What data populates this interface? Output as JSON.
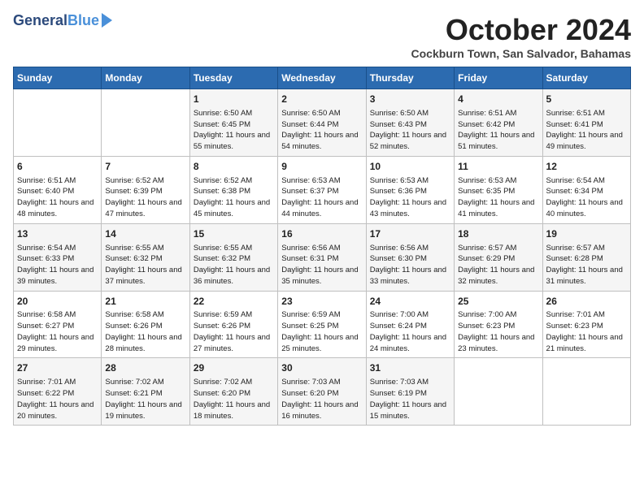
{
  "header": {
    "logo_line1": "General",
    "logo_line2": "Blue",
    "title": "October 2024",
    "location": "Cockburn Town, San Salvador, Bahamas"
  },
  "days_of_week": [
    "Sunday",
    "Monday",
    "Tuesday",
    "Wednesday",
    "Thursday",
    "Friday",
    "Saturday"
  ],
  "weeks": [
    [
      {
        "day": "",
        "info": ""
      },
      {
        "day": "",
        "info": ""
      },
      {
        "day": "1",
        "info": "Sunrise: 6:50 AM\nSunset: 6:45 PM\nDaylight: 11 hours and 55 minutes."
      },
      {
        "day": "2",
        "info": "Sunrise: 6:50 AM\nSunset: 6:44 PM\nDaylight: 11 hours and 54 minutes."
      },
      {
        "day": "3",
        "info": "Sunrise: 6:50 AM\nSunset: 6:43 PM\nDaylight: 11 hours and 52 minutes."
      },
      {
        "day": "4",
        "info": "Sunrise: 6:51 AM\nSunset: 6:42 PM\nDaylight: 11 hours and 51 minutes."
      },
      {
        "day": "5",
        "info": "Sunrise: 6:51 AM\nSunset: 6:41 PM\nDaylight: 11 hours and 49 minutes."
      }
    ],
    [
      {
        "day": "6",
        "info": "Sunrise: 6:51 AM\nSunset: 6:40 PM\nDaylight: 11 hours and 48 minutes."
      },
      {
        "day": "7",
        "info": "Sunrise: 6:52 AM\nSunset: 6:39 PM\nDaylight: 11 hours and 47 minutes."
      },
      {
        "day": "8",
        "info": "Sunrise: 6:52 AM\nSunset: 6:38 PM\nDaylight: 11 hours and 45 minutes."
      },
      {
        "day": "9",
        "info": "Sunrise: 6:53 AM\nSunset: 6:37 PM\nDaylight: 11 hours and 44 minutes."
      },
      {
        "day": "10",
        "info": "Sunrise: 6:53 AM\nSunset: 6:36 PM\nDaylight: 11 hours and 43 minutes."
      },
      {
        "day": "11",
        "info": "Sunrise: 6:53 AM\nSunset: 6:35 PM\nDaylight: 11 hours and 41 minutes."
      },
      {
        "day": "12",
        "info": "Sunrise: 6:54 AM\nSunset: 6:34 PM\nDaylight: 11 hours and 40 minutes."
      }
    ],
    [
      {
        "day": "13",
        "info": "Sunrise: 6:54 AM\nSunset: 6:33 PM\nDaylight: 11 hours and 39 minutes."
      },
      {
        "day": "14",
        "info": "Sunrise: 6:55 AM\nSunset: 6:32 PM\nDaylight: 11 hours and 37 minutes."
      },
      {
        "day": "15",
        "info": "Sunrise: 6:55 AM\nSunset: 6:32 PM\nDaylight: 11 hours and 36 minutes."
      },
      {
        "day": "16",
        "info": "Sunrise: 6:56 AM\nSunset: 6:31 PM\nDaylight: 11 hours and 35 minutes."
      },
      {
        "day": "17",
        "info": "Sunrise: 6:56 AM\nSunset: 6:30 PM\nDaylight: 11 hours and 33 minutes."
      },
      {
        "day": "18",
        "info": "Sunrise: 6:57 AM\nSunset: 6:29 PM\nDaylight: 11 hours and 32 minutes."
      },
      {
        "day": "19",
        "info": "Sunrise: 6:57 AM\nSunset: 6:28 PM\nDaylight: 11 hours and 31 minutes."
      }
    ],
    [
      {
        "day": "20",
        "info": "Sunrise: 6:58 AM\nSunset: 6:27 PM\nDaylight: 11 hours and 29 minutes."
      },
      {
        "day": "21",
        "info": "Sunrise: 6:58 AM\nSunset: 6:26 PM\nDaylight: 11 hours and 28 minutes."
      },
      {
        "day": "22",
        "info": "Sunrise: 6:59 AM\nSunset: 6:26 PM\nDaylight: 11 hours and 27 minutes."
      },
      {
        "day": "23",
        "info": "Sunrise: 6:59 AM\nSunset: 6:25 PM\nDaylight: 11 hours and 25 minutes."
      },
      {
        "day": "24",
        "info": "Sunrise: 7:00 AM\nSunset: 6:24 PM\nDaylight: 11 hours and 24 minutes."
      },
      {
        "day": "25",
        "info": "Sunrise: 7:00 AM\nSunset: 6:23 PM\nDaylight: 11 hours and 23 minutes."
      },
      {
        "day": "26",
        "info": "Sunrise: 7:01 AM\nSunset: 6:23 PM\nDaylight: 11 hours and 21 minutes."
      }
    ],
    [
      {
        "day": "27",
        "info": "Sunrise: 7:01 AM\nSunset: 6:22 PM\nDaylight: 11 hours and 20 minutes."
      },
      {
        "day": "28",
        "info": "Sunrise: 7:02 AM\nSunset: 6:21 PM\nDaylight: 11 hours and 19 minutes."
      },
      {
        "day": "29",
        "info": "Sunrise: 7:02 AM\nSunset: 6:20 PM\nDaylight: 11 hours and 18 minutes."
      },
      {
        "day": "30",
        "info": "Sunrise: 7:03 AM\nSunset: 6:20 PM\nDaylight: 11 hours and 16 minutes."
      },
      {
        "day": "31",
        "info": "Sunrise: 7:03 AM\nSunset: 6:19 PM\nDaylight: 11 hours and 15 minutes."
      },
      {
        "day": "",
        "info": ""
      },
      {
        "day": "",
        "info": ""
      }
    ]
  ]
}
